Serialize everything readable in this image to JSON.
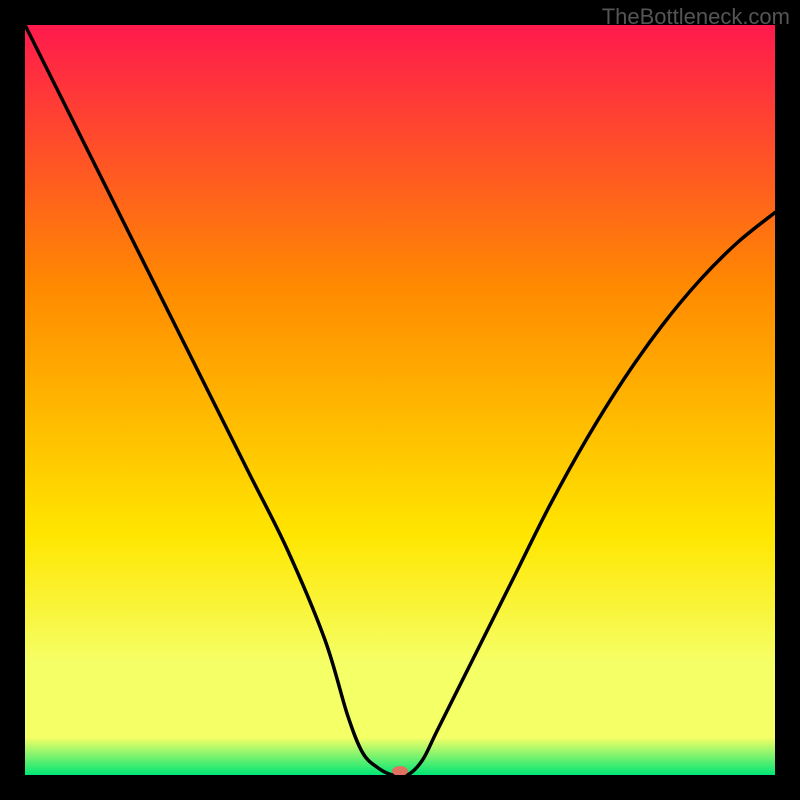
{
  "watermark": "TheBottleneck.com",
  "chart_data": {
    "type": "line",
    "title": "",
    "xlabel": "",
    "ylabel": "",
    "xlim": [
      0,
      100
    ],
    "ylim": [
      0,
      100
    ],
    "background_gradient": {
      "top": "#ff1a4d",
      "mid_upper": "#ff8a00",
      "mid": "#ffe600",
      "mid_lower": "#f5ff66",
      "bottom": "#00e676"
    },
    "series": [
      {
        "name": "curve",
        "x": [
          0,
          5,
          10,
          15,
          20,
          25,
          30,
          35,
          40,
          43,
          45,
          47,
          49,
          51,
          53,
          55,
          60,
          65,
          70,
          75,
          80,
          85,
          90,
          95,
          100
        ],
        "y": [
          100,
          90,
          80,
          70,
          60,
          50,
          40,
          30,
          18,
          8,
          3,
          1,
          0,
          0,
          2,
          6,
          16,
          26,
          36,
          45,
          53,
          60,
          66,
          71,
          75
        ]
      }
    ],
    "marker": {
      "name": "optimal-point",
      "x": 50,
      "y": 0,
      "color": "#e07060",
      "rx": 8,
      "ry": 5
    }
  }
}
